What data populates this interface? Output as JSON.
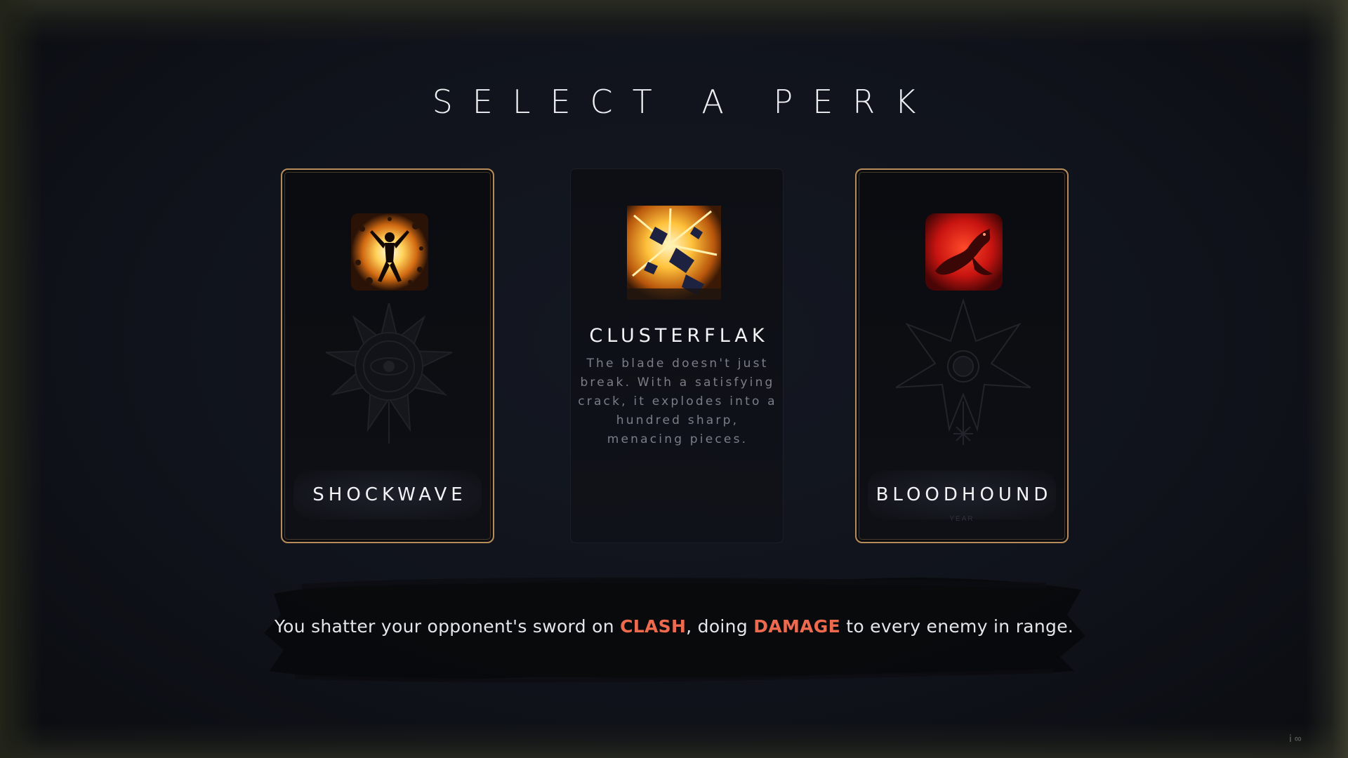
{
  "screen": {
    "title": "SELECT A PERK"
  },
  "perks": [
    {
      "name": "SHOCKWAVE",
      "icon": "shockwave-icon",
      "emblem": "sun-eye-emblem",
      "state": "face-down-framed"
    },
    {
      "name": "CLUSTERFLAK",
      "icon": "clusterflak-icon",
      "description": "The blade doesn't just break. With a satisfying crack, it explodes into a hundred sharp, menacing pieces.",
      "state": "selected-revealed"
    },
    {
      "name": "BLOODHOUND",
      "icon": "bloodhound-icon",
      "emblem": "star-emblem",
      "subline": "YEAR",
      "state": "face-down-framed"
    }
  ],
  "perk_description": {
    "before": "You shatter your opponent's sword on ",
    "keyword1": "CLASH",
    "middle": ", doing ",
    "keyword2": "DAMAGE",
    "after": " to every enemy in range."
  },
  "colors": {
    "background": "#10131b",
    "card_frame": "#b88c5a",
    "keyword": "#ee6a4f",
    "title": "#eef0f4",
    "muted_text": "#7b7e88"
  }
}
